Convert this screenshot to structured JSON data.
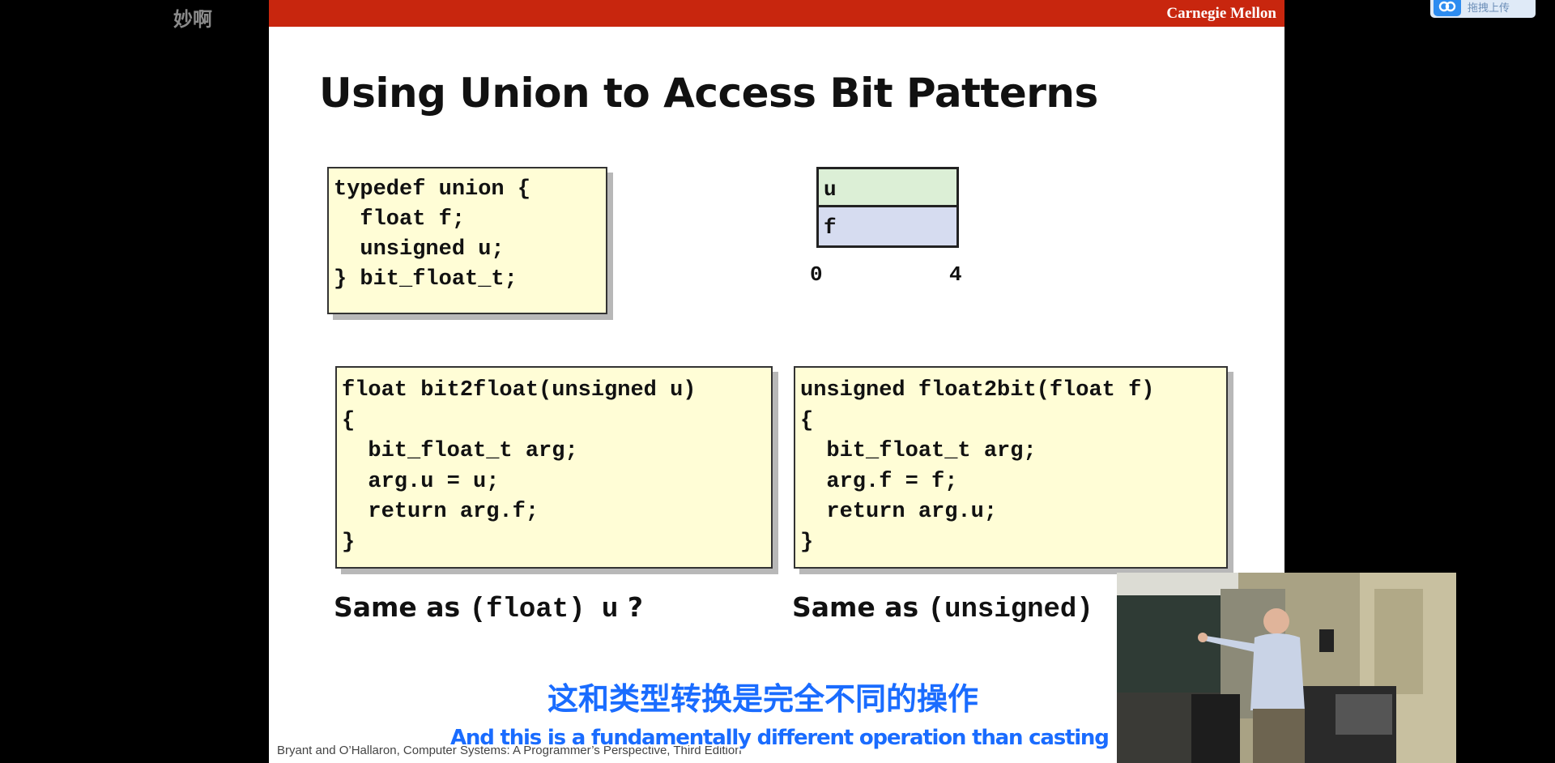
{
  "overlay": {
    "watermark": "妙啊",
    "upload_label": "拖拽上传"
  },
  "slide": {
    "brand": "Carnegie Mellon",
    "title": "Using Union to Access Bit Patterns",
    "typedef_lines": [
      "typedef union {",
      "  float f;",
      "  unsigned u;",
      "} bit_float_t;"
    ],
    "union_diagram": {
      "top_cell": "u",
      "bottom_cell": "f",
      "start_offset": "0",
      "end_offset": "4"
    },
    "bit2float_lines": [
      "float bit2float(unsigned u)",
      "{",
      "  bit_float_t arg;",
      "  arg.u = u;",
      "  return arg.f;",
      "}"
    ],
    "float2bit_lines": [
      "unsigned float2bit(float f)",
      "{",
      "  bit_float_t arg;",
      "  arg.f = f;",
      "  return arg.u;",
      "}"
    ],
    "caption_left": {
      "prefix": "Same as ",
      "code": "(float)  u",
      "suffix": " ?"
    },
    "caption_right": {
      "prefix": "Same as ",
      "code": "(unsigned)"
    },
    "footer": "Bryant and O’Hallaron, Computer Systems: A Programmer’s Perspective, Third Edition"
  },
  "subtitles": {
    "chinese": "这和类型转换是完全不同的操作",
    "english": "And this is a fundamentally different operation than casting"
  }
}
